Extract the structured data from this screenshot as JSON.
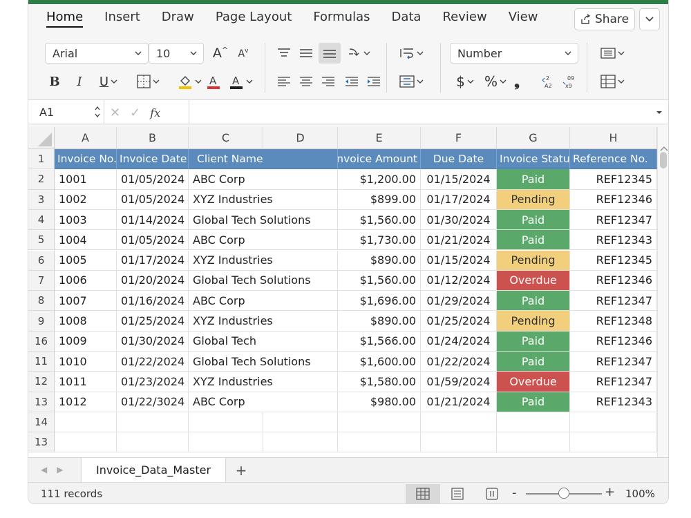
{
  "tabs": [
    "Home",
    "Insert",
    "Draw",
    "Page Layout",
    "Formulas",
    "Data",
    "Review",
    "View"
  ],
  "share_label": "Share",
  "ribbon": {
    "font_name": "Arial",
    "font_size": "10",
    "number_format": "Number",
    "bold": "B",
    "italic": "I",
    "underline": "U",
    "currency_symbol": "$",
    "percent_symbol": "%",
    "comma_symbol": "❟",
    "grow_font": "A",
    "shrink_font": "A"
  },
  "formula_bar": {
    "cell_ref": "A1",
    "fx": "fx",
    "value": ""
  },
  "columns": [
    "A",
    "B",
    "C",
    "D",
    "E",
    "F",
    "G",
    "H"
  ],
  "row_numbers": [
    "1",
    "2",
    "3",
    "4",
    "5",
    "6",
    "7",
    "8",
    "9",
    "16",
    "11",
    "12",
    "13",
    "14",
    "13"
  ],
  "headers": [
    "Invoice No.",
    "Invoice Date",
    "Client Name",
    "Invoice Amount",
    "Due Date",
    "Invoice Status",
    "Reference No."
  ],
  "rows": [
    [
      "1001",
      "01/05/2024",
      "ABC Corp",
      "$1,200.00",
      "01/15/2024",
      "Paid",
      "REF12345"
    ],
    [
      "1002",
      "01/05/2024",
      "XYZ Industries",
      "$899.00",
      "01/17/2024",
      "Pending",
      "REF12346"
    ],
    [
      "1003",
      "01/14/2024",
      "Global Tech Solutions",
      "$1,560.00",
      "01/30/2024",
      "Paid",
      "REF12347"
    ],
    [
      "1004",
      "01/05/2024",
      "ABC Corp",
      "$1,730.00",
      "01/21/2024",
      "Paid",
      "REF12343"
    ],
    [
      "1005",
      "01/17/2024",
      "XYZ Industries",
      "$890.00",
      "01/15/2024",
      "Pending",
      "REF12345"
    ],
    [
      "1006",
      "01/20/2024",
      "Global Tech Solutions",
      "$1,560.00",
      "01/12/2024",
      "Overdue",
      "REF12346"
    ],
    [
      "1007",
      "01/16/2024",
      "ABC Corp",
      "$1,696.00",
      "01/29/2024",
      "Paid",
      "REF12347"
    ],
    [
      "1008",
      "01/25/2024",
      "XYZ Industries",
      "$890.00",
      "01/25/2024",
      "Pending",
      "REF12348"
    ],
    [
      "1009",
      "01/30/2024",
      "Global Tech",
      "$1,566.00",
      "01/24/2024",
      "Paid",
      "REF12346"
    ],
    [
      "1010",
      "01/22/2024",
      "Global Tech Solutions",
      "$1,600.00",
      "01/22/2024",
      "Paid",
      "REF12347"
    ],
    [
      "1011",
      "01/23/2024",
      "XYZ Industries",
      "$1,580.00",
      "01/59/2024",
      "Overdue",
      "REF12347"
    ],
    [
      "1012",
      "01/22/3024",
      "ABC Corp",
      "$980.00",
      "01/21/2024",
      "Paid",
      "REF12343"
    ]
  ],
  "status_colors": {
    "Paid": "#5aa86a",
    "Pending": "#f2cf7d",
    "Overdue": "#cc5250"
  },
  "header_color": "#5b8bbd",
  "sheet_tab": "Invoice_Data_Master",
  "add_sheet": "+",
  "status_text": "111 records",
  "zoom": {
    "minus": "-",
    "plus": "+",
    "level": "100%"
  }
}
